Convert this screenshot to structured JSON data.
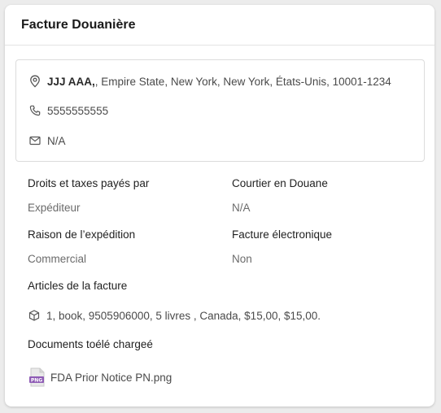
{
  "card": {
    "title": "Facture Douanière"
  },
  "address": {
    "name": "JJJ AAA,",
    "line": ", Empire State, New York, New York, États-Unis, 10001-1234",
    "phone": "5555555555",
    "email": "N/A",
    "icons": {
      "location": "location-pin-icon",
      "phone": "phone-icon",
      "email": "mail-icon"
    }
  },
  "fields": {
    "duties_label": "Droits et taxes payés par",
    "duties_value": "Expéditeur",
    "broker_label": "Courtier en Douane",
    "broker_value": "N/A",
    "reason_label": "Raison de l’expédition",
    "reason_value": "Commercial",
    "einvoice_label": "Facture électronique",
    "einvoice_value": "Non"
  },
  "invoice_items": {
    "label": "Articles de la facture",
    "items": [
      {
        "text": "1, book, 9505906000, 5 livres , Canada, $15,00, $15,00.",
        "icon": "box-icon"
      }
    ]
  },
  "documents": {
    "label": "Documents toélé chargeé",
    "files": [
      {
        "name": "FDA Prior Notice PN.png",
        "type_badge": "PNG",
        "icon": "png-file-icon"
      }
    ]
  },
  "colors": {
    "badge_purple": "#8e5bb5",
    "icon_gray": "#555555"
  }
}
